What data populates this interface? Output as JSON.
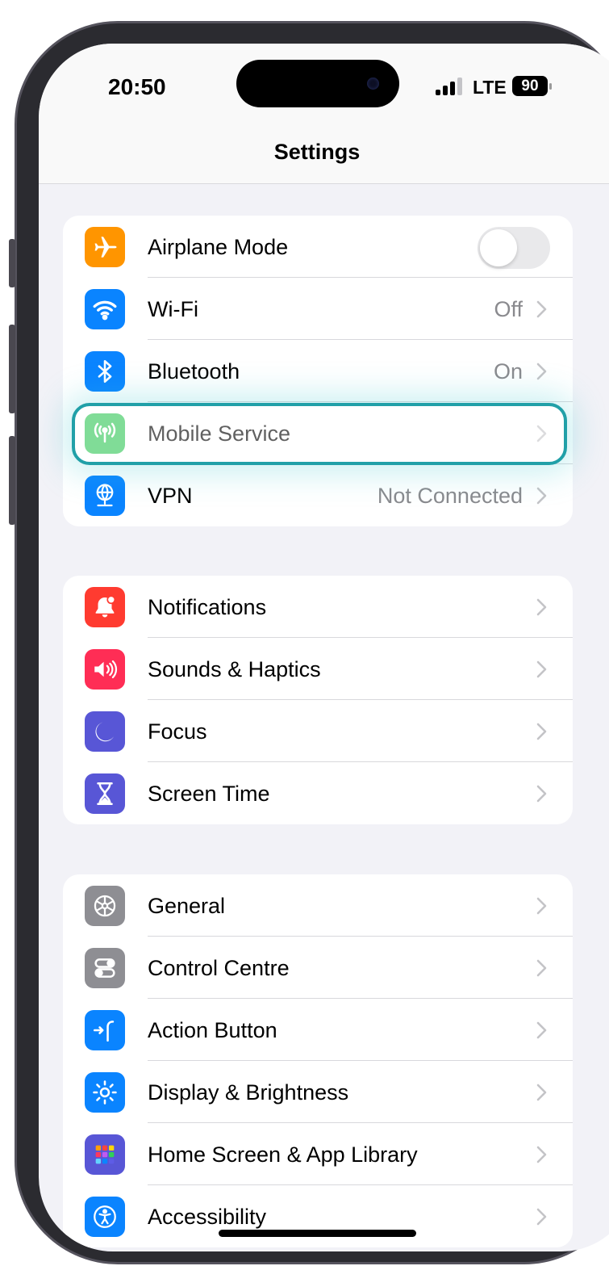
{
  "status_bar": {
    "time": "20:50",
    "network": "LTE",
    "battery": "90"
  },
  "header": {
    "title": "Settings"
  },
  "groups": [
    {
      "items": [
        {
          "label": "Airplane Mode",
          "icon": "airplane-icon",
          "color": "#ff9500",
          "control": "toggle",
          "toggle_on": false
        },
        {
          "label": "Wi-Fi",
          "icon": "wifi-icon",
          "color": "#0a84ff",
          "value": "Off"
        },
        {
          "label": "Bluetooth",
          "icon": "bluetooth-icon",
          "color": "#0a84ff",
          "value": "On"
        },
        {
          "label": "Mobile Service",
          "icon": "antenna-icon",
          "color": "#34c759",
          "value": "",
          "highlighted": true
        },
        {
          "label": "VPN",
          "icon": "globe-network-icon",
          "color": "#0a84ff",
          "value": "Not Connected"
        }
      ]
    },
    {
      "items": [
        {
          "label": "Notifications",
          "icon": "bell-icon",
          "color": "#ff3b30"
        },
        {
          "label": "Sounds & Haptics",
          "icon": "speaker-icon",
          "color": "#ff2d55"
        },
        {
          "label": "Focus",
          "icon": "moon-icon",
          "color": "#5856d6"
        },
        {
          "label": "Screen Time",
          "icon": "hourglass-icon",
          "color": "#5856d6"
        }
      ]
    },
    {
      "items": [
        {
          "label": "General",
          "icon": "gear-icon",
          "color": "#8e8e93"
        },
        {
          "label": "Control Centre",
          "icon": "switches-icon",
          "color": "#8e8e93"
        },
        {
          "label": "Action Button",
          "icon": "action-button-icon",
          "color": "#0a84ff"
        },
        {
          "label": "Display & Brightness",
          "icon": "sun-icon",
          "color": "#0a84ff"
        },
        {
          "label": "Home Screen & App Library",
          "icon": "app-grid-icon",
          "color": "#5856d6"
        },
        {
          "label": "Accessibility",
          "icon": "accessibility-icon",
          "color": "#0a84ff"
        }
      ]
    }
  ],
  "accent": "#21a0a8"
}
